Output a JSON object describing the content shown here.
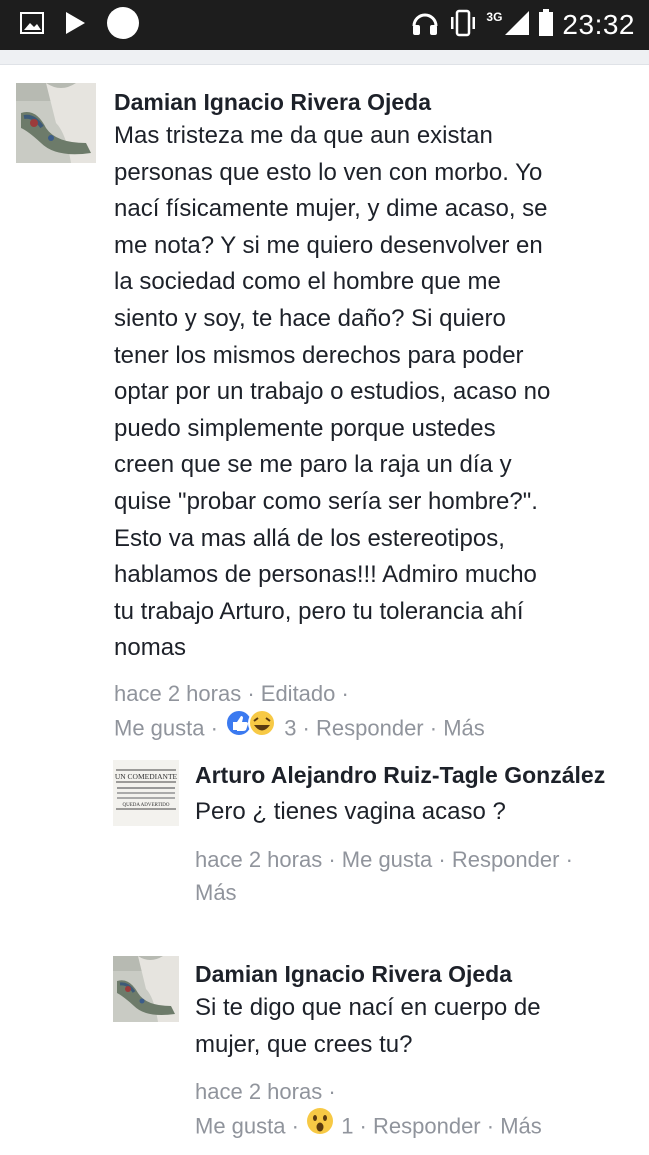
{
  "status_bar": {
    "network": "3G",
    "time": "23:32"
  },
  "comments": [
    {
      "author": "Damian Ignacio Rivera Ojeda",
      "text": "Mas tristeza me da que aun existan\npersonas que esto lo ven con morbo. Yo\nnací físicamente mujer, y dime acaso, se\nme nota? Y si me quiero desenvolver en\nla sociedad como el hombre que me\nsiento y soy, te hace daño? Si quiero\ntener los mismos derechos para poder\noptar por un trabajo o estudios, acaso no\npuedo simplemente porque ustedes\ncreen que se me paro la raja un día y\nquise \"probar como sería ser hombre?\".\nEsto va mas allá de los estereotipos,\nhablamos de personas!!! Admiro mucho\ntu trabajo Arturo, pero tu tolerancia ahí\nnomas",
      "time": "hace 2 horas",
      "edited": "Editado",
      "like": "Me gusta",
      "reactions_count": "3",
      "reply": "Responder",
      "more": "Más"
    },
    {
      "author": "Arturo Alejandro Ruiz-Tagle González",
      "avatar_text": [
        "UN COMEDIANTE",
        "QUEDA ADVERTIDO"
      ],
      "text": "Pero ¿ tienes vagina acaso ?",
      "time": "hace 2 horas",
      "like": "Me gusta",
      "reply": "Responder",
      "more": "Más"
    },
    {
      "author": "Damian Ignacio Rivera Ojeda",
      "text": "Si te digo que nací en cuerpo de\nmujer, que crees tu?",
      "time": "hace 2 horas",
      "like": "Me gusta",
      "reactions_count": "1",
      "reply": "Responder",
      "more": "Más"
    }
  ],
  "colors": {
    "text": "#1d2129",
    "meta": "#90949c",
    "like_blue": "#3b7af0",
    "haha_yellow": "#f7c945"
  }
}
